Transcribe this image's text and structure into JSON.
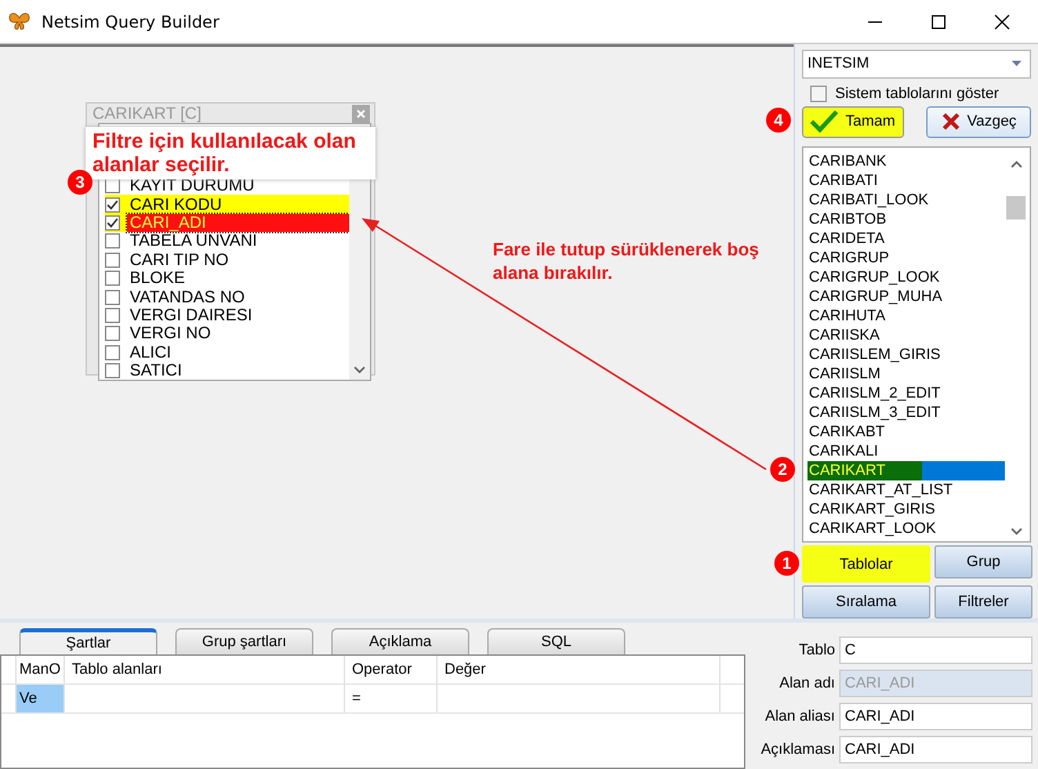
{
  "window": {
    "title": "Netsim Query Builder"
  },
  "table_window": {
    "title": "CARIKART [C]",
    "fields": [
      {
        "name": "KAYIT DURUMU",
        "checked": false,
        "selected": false
      },
      {
        "name": "CARI KODU",
        "checked": true,
        "selected": false
      },
      {
        "name": "CARI_ADI",
        "checked": true,
        "selected": true
      },
      {
        "name": "TABELA UNVANI",
        "checked": false,
        "selected": false
      },
      {
        "name": "CARI TIP NO",
        "checked": false,
        "selected": false
      },
      {
        "name": "BLOKE",
        "checked": false,
        "selected": false
      },
      {
        "name": "VATANDAS NO",
        "checked": false,
        "selected": false
      },
      {
        "name": "VERGI DAIRESI",
        "checked": false,
        "selected": false
      },
      {
        "name": "VERGI NO",
        "checked": false,
        "selected": false
      },
      {
        "name": "ALICI",
        "checked": false,
        "selected": false
      },
      {
        "name": "SATICI",
        "checked": false,
        "selected": false
      }
    ]
  },
  "database": {
    "value": "INETSIM"
  },
  "show_system_tables": {
    "label": "Sistem tablolarını göster",
    "checked": false
  },
  "ok_button": {
    "label": "Tamam",
    "highlighted": true
  },
  "cancel_button": {
    "label": "Vazgeç"
  },
  "tables": [
    {
      "name": "CARIBANK",
      "selected": false
    },
    {
      "name": "CARIBATI",
      "selected": false
    },
    {
      "name": "CARIBATI_LOOK",
      "selected": false
    },
    {
      "name": "CARIBTOB",
      "selected": false
    },
    {
      "name": "CARIDETA",
      "selected": false
    },
    {
      "name": "CARIGRUP",
      "selected": false
    },
    {
      "name": "CARIGRUP_LOOK",
      "selected": false
    },
    {
      "name": "CARIGRUP_MUHA",
      "selected": false
    },
    {
      "name": "CARIHUTA",
      "selected": false
    },
    {
      "name": "CARIISKA",
      "selected": false
    },
    {
      "name": "CARIISLEM_GIRIS",
      "selected": false
    },
    {
      "name": "CARIISLM",
      "selected": false
    },
    {
      "name": "CARIISLM_2_EDIT",
      "selected": false
    },
    {
      "name": "CARIISLM_3_EDIT",
      "selected": false
    },
    {
      "name": "CARIKABT",
      "selected": false
    },
    {
      "name": "CARIKALI",
      "selected": false
    },
    {
      "name": "CARIKART",
      "selected": true
    },
    {
      "name": "CARIKART_AT_LIST",
      "selected": false
    },
    {
      "name": "CARIKART_GIRIS",
      "selected": false
    },
    {
      "name": "CARIKART_LOOK",
      "selected": false
    }
  ],
  "view_buttons": [
    {
      "label": "Tablolar",
      "selected": true
    },
    {
      "label": "Grup",
      "selected": false
    },
    {
      "label": "Sıralama",
      "selected": false
    },
    {
      "label": "Filtreler",
      "selected": false
    }
  ],
  "condition_tabs": [
    {
      "label": "Şartlar",
      "selected": true
    },
    {
      "label": "Grup şartları",
      "selected": false
    },
    {
      "label": "Açıklama",
      "selected": false
    },
    {
      "label": "SQL",
      "selected": false
    }
  ],
  "grid": {
    "columns": [
      "ManO",
      "Tablo alanları",
      "Operator",
      "Değer"
    ],
    "rows": [
      {
        "cells": [
          "Ve",
          null,
          "=",
          null
        ],
        "selected": true
      }
    ]
  },
  "field_form": [
    {
      "label": "Tablo",
      "value": "C",
      "disabled": false
    },
    {
      "label": "Alan adı",
      "value": "CARI_ADI",
      "disabled": true
    },
    {
      "label": "Alan aliası",
      "value": "CARI_ADI",
      "disabled": false
    },
    {
      "label": "Açıklaması",
      "value": "CARI_ADI",
      "disabled": false
    }
  ],
  "annotations": {
    "field_note": "Filtre için kullanılacak olan alanlar seçilir.",
    "drag_note": "Fare ile tutup sürüklenerek boş alana bırakılır.",
    "markers": [
      "1",
      "2",
      "3",
      "4"
    ]
  }
}
